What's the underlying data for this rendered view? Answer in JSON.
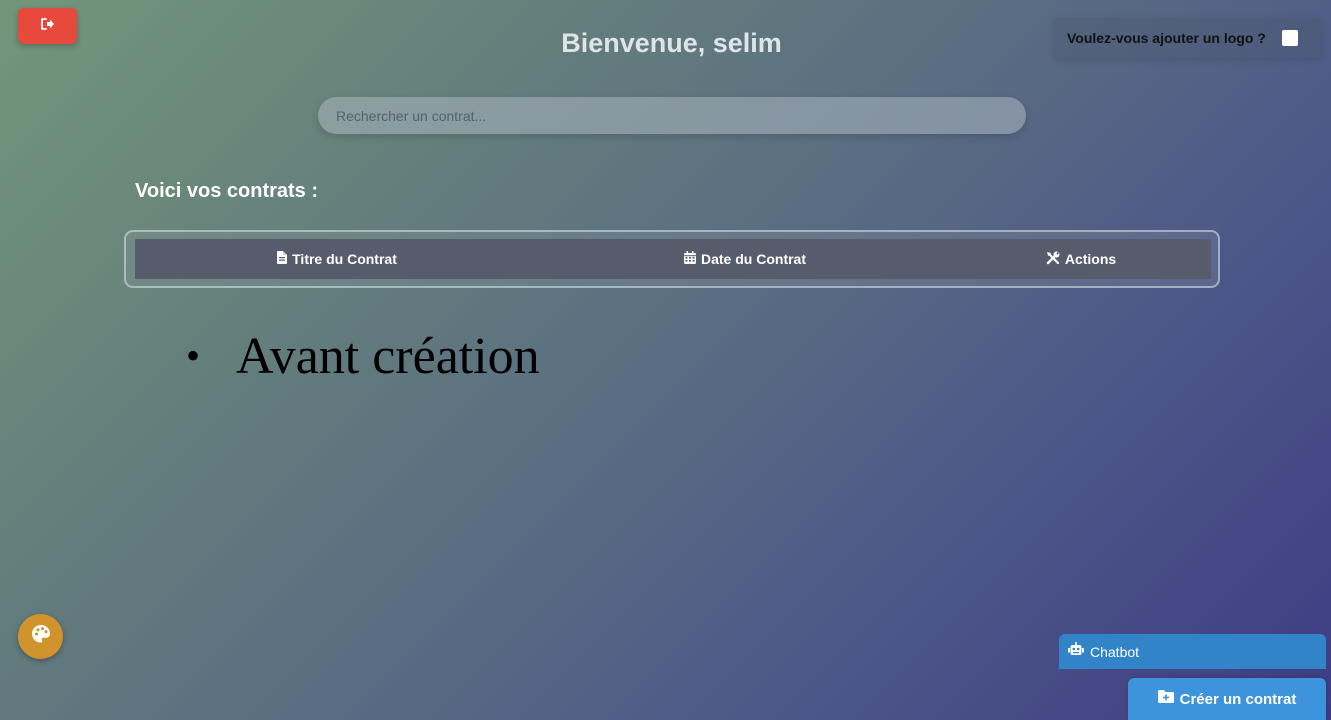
{
  "header": {
    "title": "Bienvenue, selim",
    "logout_icon": "sign-out-icon",
    "logout_color": "#e74a3d"
  },
  "logo_option": {
    "label": "Voulez-vous ajouter un logo ?",
    "checked": false
  },
  "search": {
    "placeholder": "Rechercher un contrat...",
    "value": ""
  },
  "contracts": {
    "heading": "Voici vos contrats :",
    "columns": [
      {
        "label": "Titre du Contrat",
        "icon": "file-icon"
      },
      {
        "label": "Date du Contrat",
        "icon": "calendar-icon"
      },
      {
        "label": "Actions",
        "icon": "tools-icon"
      }
    ],
    "items": [
      {
        "label": "Avant création"
      }
    ]
  },
  "theme": {
    "icon": "palette-icon",
    "color": "#d1932c"
  },
  "chatbot": {
    "label": "Chatbot",
    "icon": "robot-icon",
    "color": "#3184c7"
  },
  "create": {
    "label": "Créer un contrat",
    "icon": "folder-plus-icon",
    "color": "#3d93dc"
  }
}
